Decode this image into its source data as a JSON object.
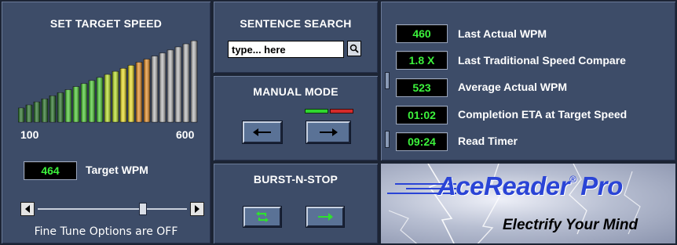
{
  "speed_panel": {
    "title": "SET TARGET SPEED",
    "range_min_label": "100",
    "range_max_label": "600",
    "target_wpm_value": "464",
    "target_wpm_label": "Target WPM",
    "fine_tune_status": "Fine Tune Options are OFF",
    "meter_colors": {
      "dark_green": "#1d6b1d",
      "green": "#43c92a",
      "yellow_green": "#b9e21f",
      "yellow": "#f1e21b",
      "orange": "#e88a1c",
      "gray": "#b9b9b9"
    }
  },
  "search_panel": {
    "title": "SENTENCE SEARCH",
    "input_value": "type... here",
    "search_icon": "magnifier-icon"
  },
  "manual_panel": {
    "title": "MANUAL MODE",
    "back_icon": "arrow-left-icon",
    "forward_icon": "arrow-right-icon",
    "indicator_colors": [
      "#2fd62f",
      "#d42a2a"
    ]
  },
  "burst_panel": {
    "title": "BURST-N-STOP",
    "loop_icon": "loop-arrow-icon",
    "forward_icon": "arrow-right-icon"
  },
  "stats_panel": {
    "rows": [
      {
        "value": "460",
        "label": "Last Actual WPM"
      },
      {
        "value": "1.8 X",
        "label": "Last Traditional Speed Compare"
      },
      {
        "value": "523",
        "label": "Average Actual WPM"
      },
      {
        "value": "01:02",
        "label": "Completion ETA at Target Speed"
      },
      {
        "value": "09:24",
        "label": "Read Timer"
      }
    ]
  },
  "brand_panel": {
    "logo_main": "AceReader",
    "logo_reg": "®",
    "logo_pro": "Pro",
    "tagline": "Electrify Your Mind",
    "accent_color": "#2a44d6"
  }
}
